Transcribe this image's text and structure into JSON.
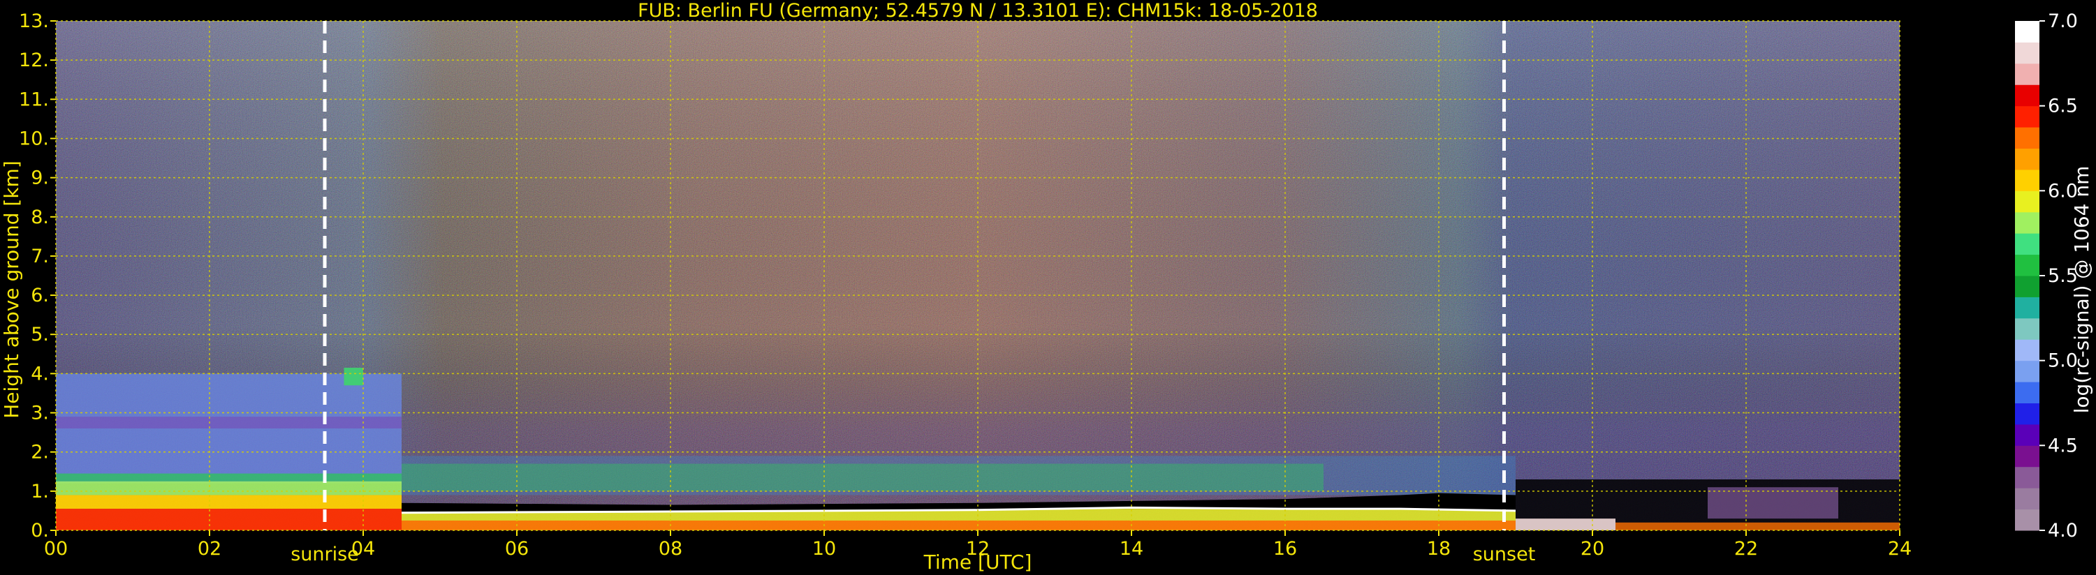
{
  "chart_data": {
    "type": "heatmap",
    "title": "FUB: Berlin FU (Germany; 52.4579 N / 13.3101 E):    CHM15k: 18-05-2018",
    "xlabel": "Time [UTC]",
    "ylabel": "Height above ground [km]",
    "xlim": [
      0,
      24
    ],
    "ylim": [
      0,
      13
    ],
    "x_ticks": [
      "00",
      "02",
      "04",
      "06",
      "08",
      "10",
      "12",
      "14",
      "16",
      "18",
      "20",
      "22",
      "24"
    ],
    "y_ticks": [
      "0.",
      "1.",
      "2.",
      "3.",
      "4.",
      "5.",
      "6.",
      "7.",
      "8.",
      "9.",
      "10.",
      "11.",
      "12.",
      "13."
    ],
    "grid": true,
    "markers": [
      {
        "label": "sunrise",
        "x": 3.5
      },
      {
        "label": "sunset",
        "x": 18.85
      }
    ],
    "colorbar": {
      "label": "log(rc-signal) @ 1064 nm",
      "range": [
        4.0,
        7.0
      ],
      "ticks": [
        "4.0",
        "4.5",
        "5.0",
        "5.5",
        "6.0",
        "6.5",
        "7.0"
      ],
      "colors": [
        "#a890a8",
        "#9a7ca0",
        "#8a5a98",
        "#7a1090",
        "#5a00b8",
        "#2020e8",
        "#3c6cf0",
        "#7aa0f0",
        "#a0b8f8",
        "#7ec8c0",
        "#20b0a0",
        "#10a030",
        "#20c040",
        "#40e080",
        "#a0f060",
        "#e8f020",
        "#ffd000",
        "#ffa000",
        "#ff7000",
        "#ff2000",
        "#e80000",
        "#f0b0b0",
        "#f0d8d8",
        "#ffffff"
      ]
    }
  },
  "colors": {
    "axis_text": "#f5e60a",
    "grid": "#d8d000",
    "background": "#000000",
    "marker_line": "#ffffff"
  }
}
